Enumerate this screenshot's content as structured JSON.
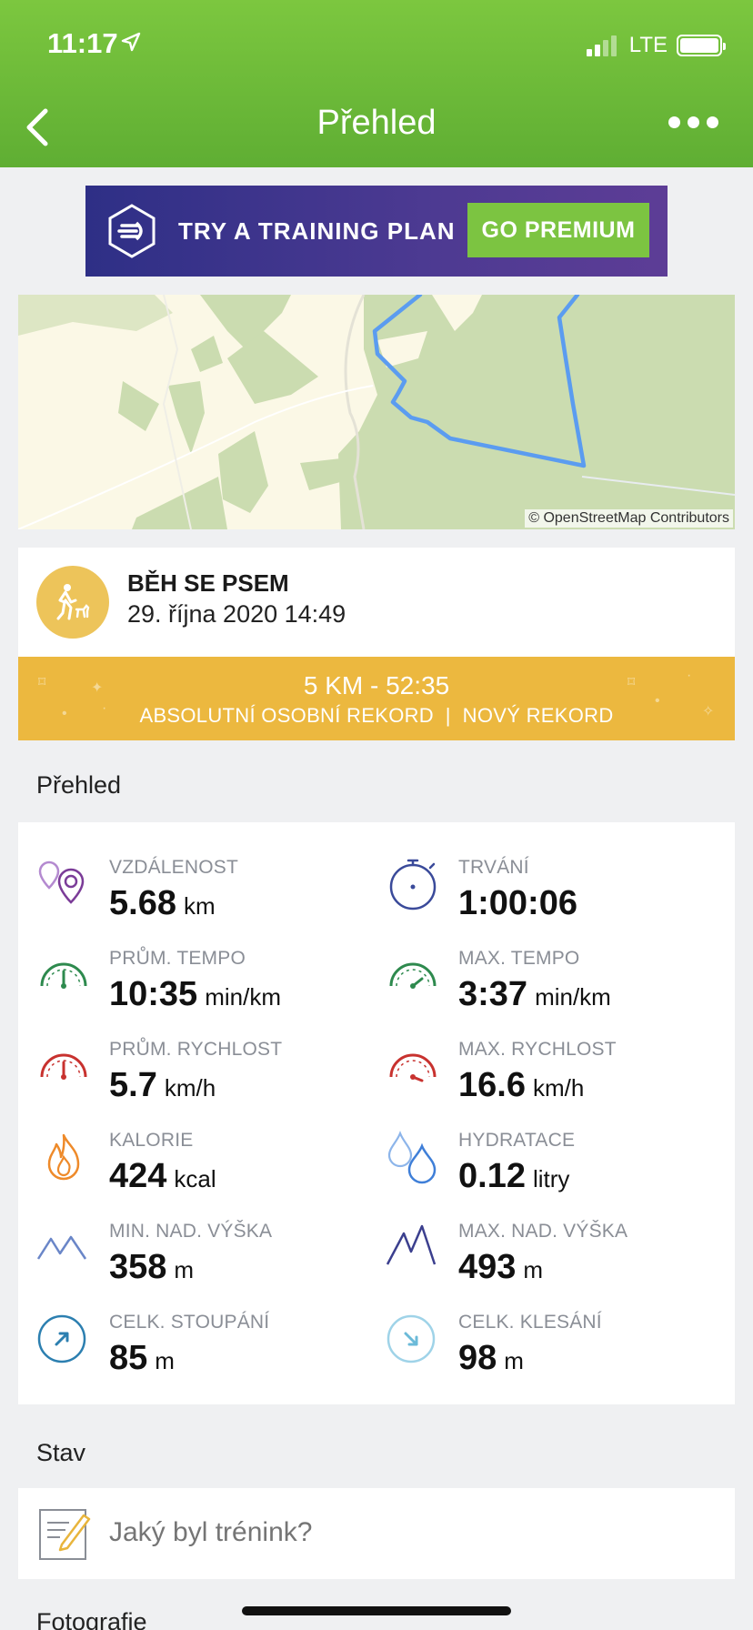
{
  "status_bar": {
    "time": "11:17",
    "network": "LTE"
  },
  "header": {
    "title": "Přehled"
  },
  "banner": {
    "text": "TRY A TRAINING PLAN",
    "button": "GO PREMIUM"
  },
  "map": {
    "credit": "© OpenStreetMap Contributors"
  },
  "activity": {
    "name": "BĚH SE PSEM",
    "date": "29. října 2020 14:49",
    "record_title": "5 KM - 52:35",
    "record_subtitle": "ABSOLUTNÍ OSOBNÍ REKORD  |  NOVÝ REKORD"
  },
  "overview_title": "Přehled",
  "stats": [
    {
      "label": "VZDÁLENOST",
      "value": "5.68",
      "unit": "km",
      "icon": "location-pins-icon"
    },
    {
      "label": "TRVÁNÍ",
      "value": "1:00:06",
      "unit": "",
      "icon": "stopwatch-icon"
    },
    {
      "label": "PRŮM. TEMPO",
      "value": "10:35",
      "unit": "min/km",
      "icon": "pace-gauge-icon"
    },
    {
      "label": "MAX. TEMPO",
      "value": "3:37",
      "unit": "min/km",
      "icon": "max-pace-gauge-icon"
    },
    {
      "label": "PRŮM. RYCHLOST",
      "value": "5.7",
      "unit": "km/h",
      "icon": "speed-gauge-icon"
    },
    {
      "label": "MAX. RYCHLOST",
      "value": "16.6",
      "unit": "km/h",
      "icon": "max-speed-gauge-icon"
    },
    {
      "label": "KALORIE",
      "value": "424",
      "unit": "kcal",
      "icon": "flame-icon"
    },
    {
      "label": "HYDRATACE",
      "value": "0.12",
      "unit": "litry",
      "icon": "water-drops-icon"
    },
    {
      "label": "MIN. NAD. VÝŠKA",
      "value": "358",
      "unit": "m",
      "icon": "mountain-min-icon"
    },
    {
      "label": "MAX. NAD. VÝŠKA",
      "value": "493",
      "unit": "m",
      "icon": "mountain-max-icon"
    },
    {
      "label": "CELK. STOUPÁNÍ",
      "value": "85",
      "unit": "m",
      "icon": "ascent-arrow-icon"
    },
    {
      "label": "CELK. KLESÁNÍ",
      "value": "98",
      "unit": "m",
      "icon": "descent-arrow-icon"
    }
  ],
  "status_section": {
    "title": "Stav",
    "placeholder": "Jaký byl trénink?"
  },
  "photos_title": "Fotografie",
  "colors": {
    "header_green": "#6cbb38",
    "record_yellow": "#ecb83f",
    "route_blue": "#5b9cf0"
  }
}
